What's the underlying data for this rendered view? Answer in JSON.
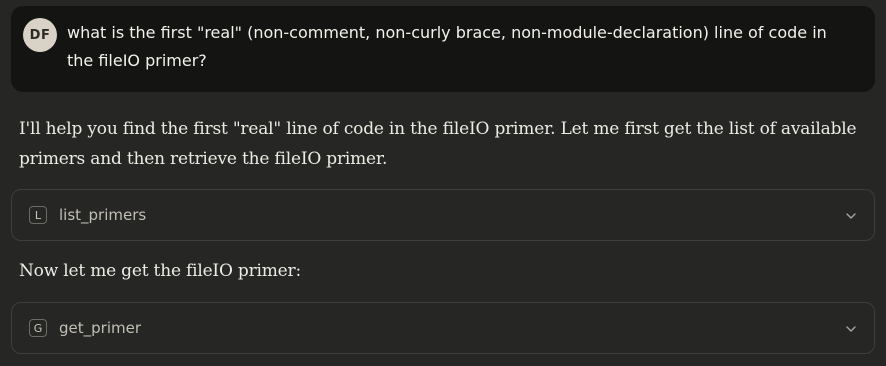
{
  "user_message": {
    "avatar_initials": "DF",
    "text": "what is the first \"real\" (non-comment, non-curly brace, non-module-declaration) line of code in the fileIO primer?"
  },
  "assistant": {
    "intro_text": "I'll help you find the first \"real\" line of code in the fileIO primer. Let me first get the list of available primers and then retrieve the fileIO primer.",
    "tool_call_1": {
      "icon_letter": "L",
      "name": "list_primers",
      "expand_icon": "chevron-down-icon"
    },
    "followup_text": "Now let me get the fileIO primer:",
    "tool_call_2": {
      "icon_letter": "G",
      "name": "get_primer",
      "expand_icon": "chevron-down-icon"
    }
  },
  "colors": {
    "background": "#262624",
    "user_bubble": "#141413",
    "avatar": "#d8d3c6",
    "card_border": "#3f3e3a"
  }
}
